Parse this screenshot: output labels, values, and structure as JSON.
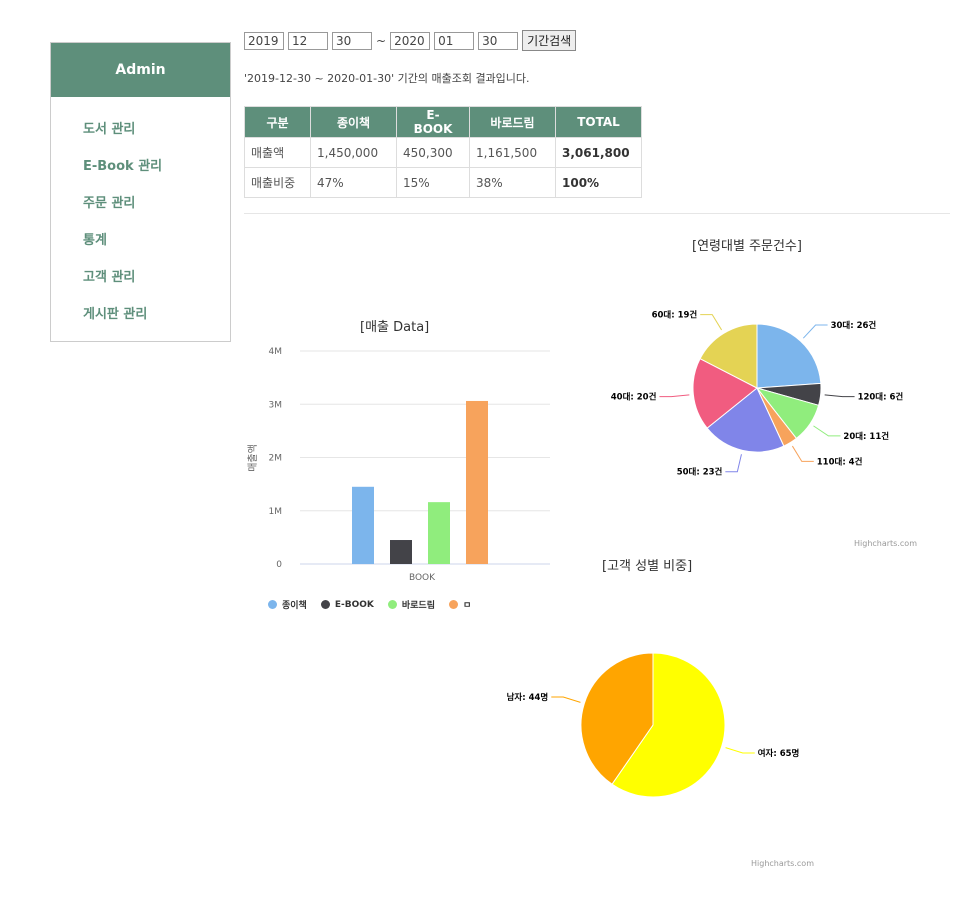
{
  "sidebar": {
    "title": "Admin",
    "items": [
      "도서 관리",
      "E-Book 관리",
      "주문 관리",
      "통계",
      "고객 관리",
      "게시판 관리"
    ]
  },
  "search": {
    "start_year": "2019",
    "start_month": "12",
    "start_day": "30",
    "separator": "~",
    "end_year": "2020",
    "end_month": "01",
    "end_day": "30",
    "button": "기간검색"
  },
  "summary_text": "'2019-12-30 ~ 2020-01-30' 기간의 매출조회 결과입니다.",
  "table": {
    "headers": [
      "구분",
      "종이책",
      "E-BOOK",
      "바로드림",
      "TOTAL"
    ],
    "rows": [
      [
        "매출액",
        "1,450,000",
        "450,300",
        "1,161,500",
        "3,061,800"
      ],
      [
        "매출비중",
        "47%",
        "15%",
        "38%",
        "100%"
      ]
    ]
  },
  "credit": "Highcharts.com",
  "chart_data": [
    {
      "type": "bar",
      "title": "[매출 Data]",
      "ylabel": "매출액",
      "categories": [
        "BOOK"
      ],
      "yticks": [
        "0",
        "1M",
        "2M",
        "3M",
        "4M"
      ],
      "ylim": [
        0,
        4000000
      ],
      "series": [
        {
          "name": "종이책",
          "color": "#7cb5ec",
          "values": [
            1450000
          ]
        },
        {
          "name": "E-BOOK",
          "color": "#434348",
          "values": [
            450300
          ]
        },
        {
          "name": "바로드림",
          "color": "#90ed7d",
          "values": [
            1161500
          ]
        },
        {
          "name": "ㅁ",
          "color": "#f7a35c",
          "values": [
            3061800
          ]
        }
      ],
      "legend": "bottom"
    },
    {
      "type": "pie",
      "title": "[연령대별 주문건수]",
      "slices": [
        {
          "label": "30대: 26건",
          "value": 26,
          "color": "#7cb5ec"
        },
        {
          "label": "120대: 6건",
          "value": 6,
          "color": "#434348"
        },
        {
          "label": "20대: 11건",
          "value": 11,
          "color": "#90ed7d"
        },
        {
          "label": "110대: 4건",
          "value": 4,
          "color": "#f7a35c"
        },
        {
          "label": "50대: 23건",
          "value": 23,
          "color": "#8085e9"
        },
        {
          "label": "40대: 20건",
          "value": 20,
          "color": "#f15c80"
        },
        {
          "label": "60대: 19건",
          "value": 19,
          "color": "#e4d354"
        }
      ]
    },
    {
      "type": "pie",
      "title": "[고객 성별 비중]",
      "slices": [
        {
          "label": "여자: 65명",
          "value": 65,
          "color": "#ffff00"
        },
        {
          "label": "남자: 44명",
          "value": 44,
          "color": "#ffa500"
        }
      ]
    }
  ]
}
